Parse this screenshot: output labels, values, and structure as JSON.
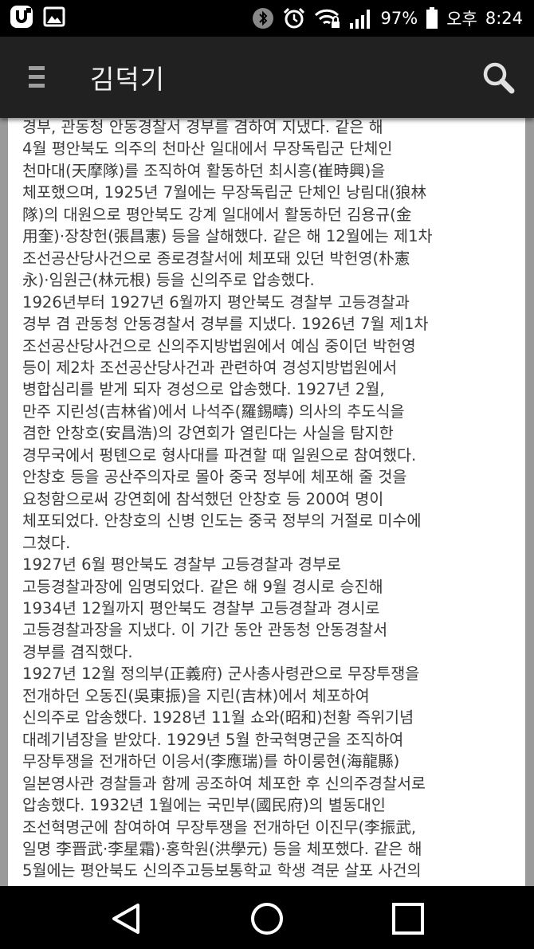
{
  "status_bar": {
    "battery_percent": "97%",
    "am_pm": "오후",
    "time": "8:24",
    "battery_level": 0.97
  },
  "app_bar": {
    "title": "김덕기"
  },
  "article": {
    "lines": [
      "경부, 관동청 안동경찰서 경부를 겸하여 지냈다. 같은 해",
      "4월 평안북도 의주의 천마산 일대에서 무장독립군 단체인",
      "천마대(天摩隊)를 조직하여 활동하던 최시흥(崔時興)을",
      "체포했으며, 1925년 7월에는 무장독립군 단체인 낭림대(狼林",
      "隊)의 대원으로 평안북도 강계 일대에서 활동하던 김용규(金",
      "用奎)·장창헌(張昌憲) 등을 살해했다. 같은 해 12월에는 제1차",
      "조선공산당사건으로 종로경찰서에 체포돼 있던 박헌영(朴憲",
      "永)·임원근(林元根) 등을 신의주로 압송했다.",
      "1926년부터 1927년 6월까지 평안북도 경찰부 고등경찰과",
      "경부 겸 관동청 안동경찰서 경부를 지냈다. 1926년 7월 제1차",
      "조선공산당사건으로 신의주지방법원에서 예심 중이던 박헌영",
      "등이 제2차 조선공산당사건과 관련하여 경성지방법원에서",
      "병합심리를 받게 되자 경성으로 압송했다. 1927년 2월,",
      "만주 지린성(吉林省)에서 나석주(羅錫疇) 의사의 추도식을",
      "겸한 안창호(安昌浩)의 강연회가 열린다는 사실을 탐지한",
      "경무국에서 펑톈으로 형사대를 파견할 때 일원으로 참여했다.",
      "안창호 등을 공산주의자로 몰아 중국 정부에 체포해 줄 것을",
      "요청함으로써 강연회에 참석했던 안창호 등 200여 명이",
      "체포되었다. 안창호의 신병 인도는 중국 정부의 거절로 미수에",
      "그쳤다.",
      "1927년 6월 평안북도 경찰부 고등경찰과 경부로",
      "고등경찰과장에 임명되었다. 같은 해 9월 경시로 승진해",
      "1934년 12월까지 평안북도 경찰부 고등경찰과 경시로",
      "고등경찰과장을 지냈다. 이 기간 동안 관동청 안동경찰서",
      "경부를 겸직했다.",
      "1927년 12월 정의부(正義府) 군사총사령관으로 무장투쟁을",
      "전개하던 오동진(吳東振)을 지린(吉林)에서 체포하여",
      "신의주로 압송했다. 1928년 11월 쇼와(昭和)천황 즉위기념",
      "대례기념장을 받았다. 1929년 5월 한국혁명군을 조직하여",
      "무장투쟁을 전개하던 이응서(李應瑞)를 하이룽현(海龍縣)",
      "일본영사관 경찰들과 함께 공조하여 체포한 후 신의주경찰서로",
      "압송했다. 1932년 1월에는 국민부(國民府)의 별동대인",
      "조선혁명군에 참여하여 무장투쟁을 전개하던 이진무(李振武,",
      "일명 李晋武·李星霜)·홍학원(洪學元) 등을 체포했다. 같은 해",
      "5월에는 평안북도 신의주고등보통학교 학생 격문 살포 사건의"
    ]
  }
}
